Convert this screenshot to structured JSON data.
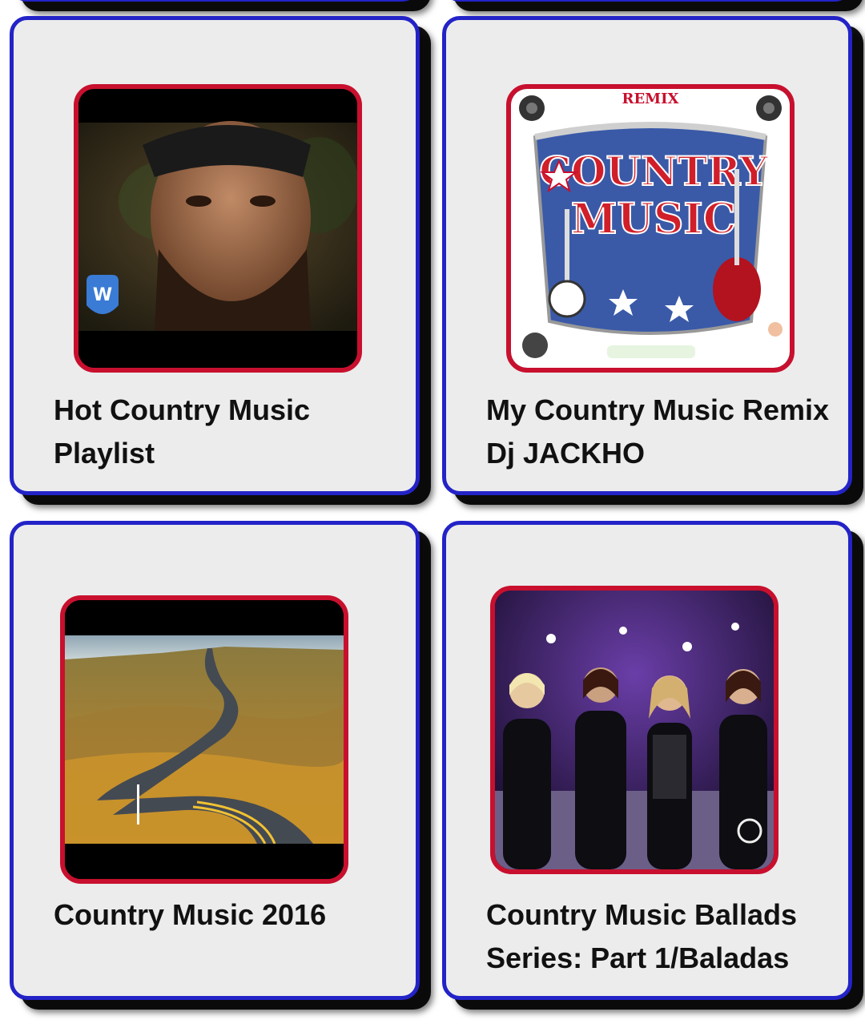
{
  "cards": [
    {
      "title": "Hot Country Music Playlist",
      "thumbnail": "video-thumbnail-bearded-singer"
    },
    {
      "title": "My Country Music Remix Dj JACKHO",
      "thumbnail": "country-music-remix-badge",
      "thumb_text": {
        "top": "REMIX",
        "main1": "COUNTRY",
        "main2": "MUSIC"
      }
    },
    {
      "title": "Country Music 2016",
      "thumbnail": "winding-prairie-road"
    },
    {
      "title": "Country Music Ballads Series: Part 1/Baladas",
      "thumbnail": "four-singers-on-stage"
    }
  ],
  "colors": {
    "card_border": "#2323c8",
    "thumb_border": "#c8102e",
    "card_bg": "#ececec"
  }
}
